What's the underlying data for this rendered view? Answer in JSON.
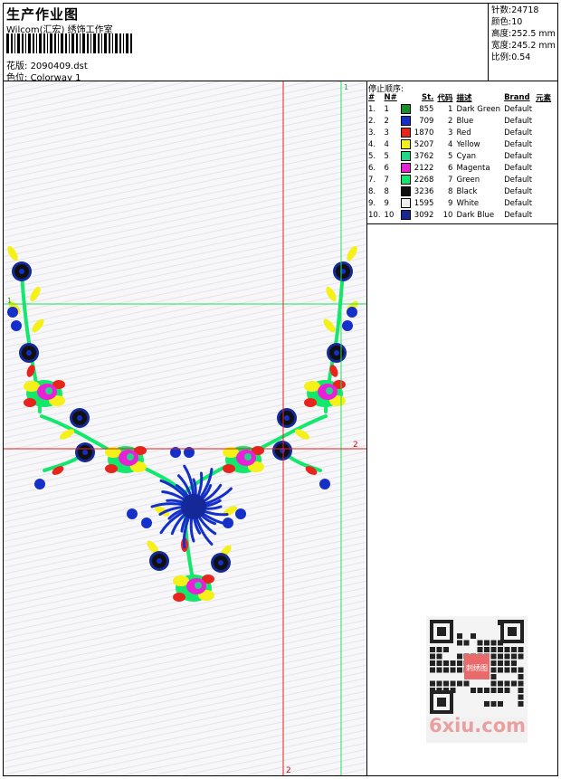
{
  "header": {
    "title": "生产作业图",
    "company": "Wilcom(汇宏) 绣饰工作室",
    "file_label": "花版:",
    "file_name": "2090409.dst",
    "colorway_label": "色位:",
    "colorway_value": "Colorway 1"
  },
  "stats": [
    {
      "label": "针数:",
      "value": "24718"
    },
    {
      "label": "颜色:",
      "value": "10"
    },
    {
      "label": "高度:",
      "value": "252.5 mm"
    },
    {
      "label": "宽度:",
      "value": "245.2 mm"
    },
    {
      "label": "比例:",
      "value": "0.54"
    }
  ],
  "stop_panel": {
    "title": "停止顺序:",
    "columns": [
      "#",
      "N#",
      "St.",
      "代码",
      "描述",
      "Brand",
      "元素"
    ],
    "rows": [
      {
        "n": "1.",
        "needle": "1",
        "st": "855",
        "code": "1",
        "desc": "Dark Green",
        "brand": "Default",
        "color": "#1a8f2a"
      },
      {
        "n": "2.",
        "needle": "2",
        "st": "709",
        "code": "2",
        "desc": "Blue",
        "brand": "Default",
        "color": "#1530c8"
      },
      {
        "n": "3.",
        "needle": "3",
        "st": "1870",
        "code": "3",
        "desc": "Red",
        "brand": "Default",
        "color": "#e8241c"
      },
      {
        "n": "4.",
        "needle": "4",
        "st": "5207",
        "code": "4",
        "desc": "Yellow",
        "brand": "Default",
        "color": "#f4f018"
      },
      {
        "n": "5.",
        "needle": "5",
        "st": "3762",
        "code": "5",
        "desc": "Cyan",
        "brand": "Default",
        "color": "#20d888"
      },
      {
        "n": "6.",
        "needle": "6",
        "st": "2122",
        "code": "6",
        "desc": "Magenta",
        "brand": "Default",
        "color": "#e820d8"
      },
      {
        "n": "7.",
        "needle": "7",
        "st": "2268",
        "code": "7",
        "desc": "Green",
        "brand": "Default",
        "color": "#14e86c"
      },
      {
        "n": "8.",
        "needle": "8",
        "st": "3236",
        "code": "8",
        "desc": "Black",
        "brand": "Default",
        "color": "#101010"
      },
      {
        "n": "9.",
        "needle": "9",
        "st": "1595",
        "code": "9",
        "desc": "White",
        "brand": "Default",
        "color": "#f0f0f0"
      },
      {
        "n": "10.",
        "needle": "10",
        "st": "3092",
        "code": "10",
        "desc": "Dark Blue",
        "brand": "Default",
        "color": "#142898"
      }
    ]
  },
  "guides": {
    "label_1": "1",
    "label_2": "2",
    "vertical_color": "#20e060",
    "cross_color": "#e02020"
  },
  "watermark": {
    "brand": "6xiu.com",
    "seal_text": "刺绣图"
  }
}
